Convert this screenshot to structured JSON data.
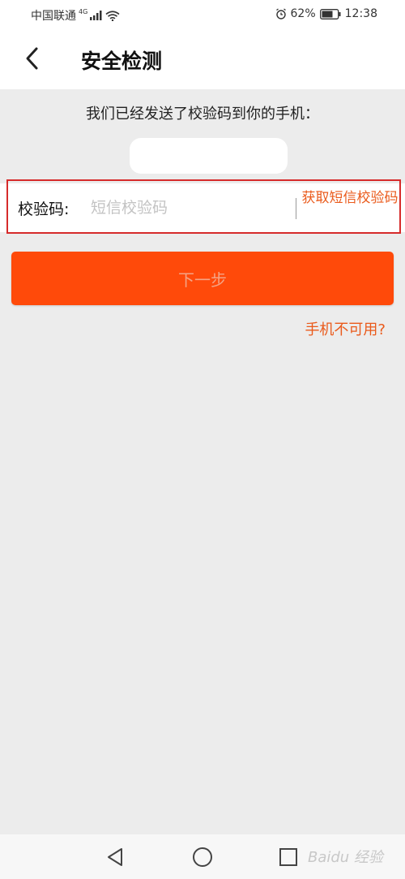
{
  "status_bar": {
    "carrier": "中国联通",
    "network": "4G",
    "battery": "62%",
    "time": "12:38"
  },
  "header": {
    "title": "安全检测",
    "back_icon": "chevron-left-icon"
  },
  "message": "我们已经发送了校验码到你的手机：",
  "code_form": {
    "label": "校验码:",
    "value": "",
    "placeholder": "短信校验码",
    "get_code_label": "获取短信校验码"
  },
  "next_button_label": "下一步",
  "phone_unavailable_link": "手机不可用?",
  "nav_bar": {
    "back": "triangle-back-icon",
    "home": "circle-home-icon",
    "recents": "square-recents-icon",
    "watermark": "Baidu 经验"
  },
  "colors": {
    "accent": "#ff4a0a",
    "link": "#ea5a1b",
    "highlight_border": "#d62b2b",
    "background": "#ececec"
  }
}
